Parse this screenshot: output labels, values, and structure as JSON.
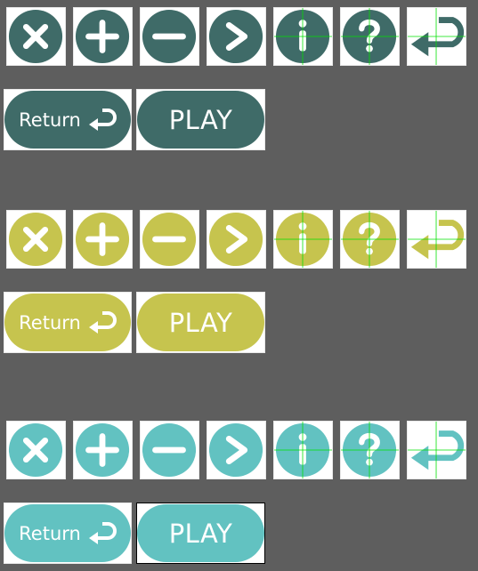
{
  "sets": [
    {
      "color": "#3f6b68",
      "icons": [
        "close-icon",
        "plus-icon",
        "minus-icon",
        "chevron-right-icon",
        "info-icon",
        "question-icon",
        "return-arrow-icon"
      ],
      "return_label": "Return",
      "play_label": "PLAY"
    },
    {
      "color": "#c6c44e",
      "icons": [
        "close-icon",
        "plus-icon",
        "minus-icon",
        "chevron-right-icon",
        "info-icon",
        "question-icon",
        "return-arrow-icon"
      ],
      "return_label": "Return",
      "play_label": "PLAY"
    },
    {
      "color": "#62c2c1",
      "icons": [
        "close-icon",
        "plus-icon",
        "minus-icon",
        "chevron-right-icon",
        "info-icon",
        "question-icon",
        "return-arrow-icon"
      ],
      "return_label": "Return",
      "play_label": "PLAY"
    }
  ],
  "guide_color": "#00e000"
}
